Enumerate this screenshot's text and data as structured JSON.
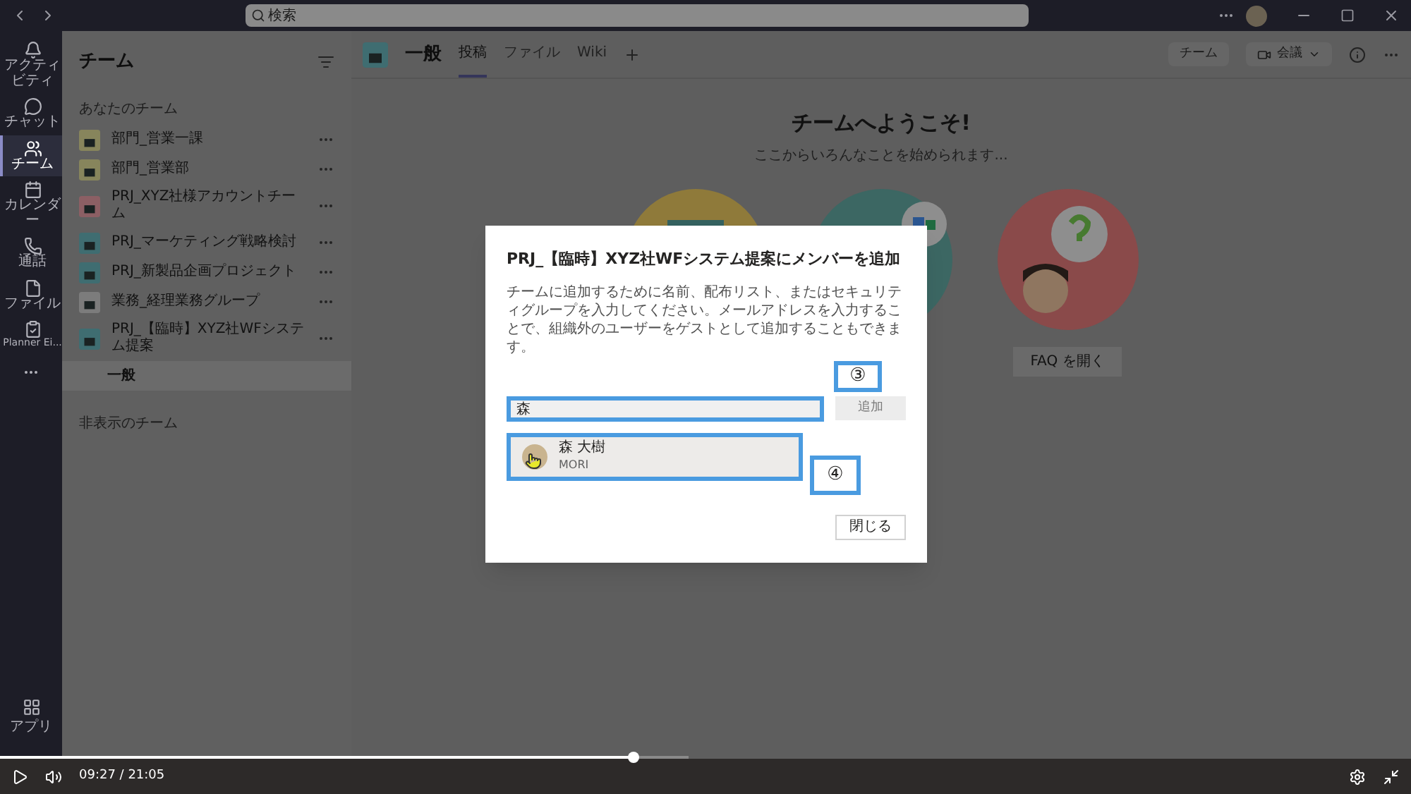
{
  "title_bar": {
    "search_placeholder": "検索"
  },
  "rail": [
    {
      "label": "アクティビティ",
      "kind": "bell",
      "selected": false
    },
    {
      "label": "チャット",
      "kind": "chat",
      "selected": false
    },
    {
      "label": "チーム",
      "kind": "teams",
      "selected": true
    },
    {
      "label": "カレンダー",
      "kind": "calendar",
      "selected": false
    },
    {
      "label": "通話",
      "kind": "phone",
      "selected": false
    },
    {
      "label": "ファイル",
      "kind": "file",
      "selected": false
    },
    {
      "label": "Planner Ei...",
      "kind": "planner",
      "selected": false
    }
  ],
  "rail_apps": {
    "label": "アプリ"
  },
  "teams_panel": {
    "title": "チーム",
    "section": "あなたのチーム",
    "teams": [
      {
        "name": "部門_営業一課",
        "color": "#87855c"
      },
      {
        "name": "部門_営業部",
        "color": "#87855c"
      },
      {
        "name": "PRJ_XYZ社様アカウントチーム",
        "color": "#8c5f64"
      },
      {
        "name": "PRJ_マーケティング戦略検討",
        "color": "#3f6d71"
      },
      {
        "name": "PRJ_新製品企画プロジェクト",
        "color": "#3f6d71"
      },
      {
        "name": "業務_経理業務グループ",
        "color": "#7c7c7c"
      },
      {
        "name": "PRJ_【臨時】XYZ社WFシステム提案",
        "color": "#3f6d71",
        "channels": [
          {
            "name": "一般",
            "selected": true
          }
        ]
      }
    ],
    "hidden_section": "非表示のチーム"
  },
  "channel_header": {
    "name": "一般",
    "tabs": [
      {
        "label": "投稿",
        "selected": true
      },
      {
        "label": "ファイル",
        "selected": false
      },
      {
        "label": "Wiki",
        "selected": false
      }
    ],
    "team_button": "チーム",
    "meet_button": "会議"
  },
  "welcome": {
    "title": "チームへようこそ!",
    "subtitle": "ここからいろんなことを始められます...",
    "faq_button": "FAQ を開く"
  },
  "dialog": {
    "title": "PRJ_【臨時】XYZ社WFシステム提案にメンバーを追加",
    "description": "チームに追加するために名前、配布リスト、またはセキュリティグループを入力してください。メールアドレスを入力することで、組織外のユーザーをゲストとして追加することもできます。",
    "input_value": "森",
    "add_button": {
      "label": "追加",
      "disabled": true
    },
    "result": {
      "name": "森 大樹",
      "subtitle": "MORI"
    },
    "close_button": "閉じる"
  },
  "callouts": [
    "③",
    "④"
  ],
  "player": {
    "time": "09:27 / 21:05",
    "level": 0.92
  }
}
